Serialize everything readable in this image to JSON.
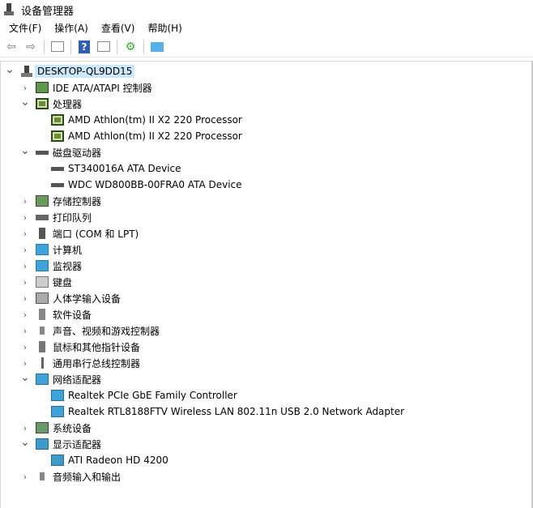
{
  "window": {
    "title": "设备管理器"
  },
  "menu": [
    "文件(F)",
    "操作(A)",
    "查看(V)",
    "帮助(H)"
  ],
  "toolbar": [
    "back-icon",
    "forward-icon",
    "show-hide-console-tree-icon",
    "help-icon",
    "properties-pane-icon",
    "update-driver-icon",
    "scan-hardware-icon"
  ],
  "tree": [
    {
      "label": "DESKTOP-QL9DD15",
      "level": 0,
      "expand": "open",
      "icon": "computer",
      "selected": true
    },
    {
      "label": "IDE ATA/ATAPI 控制器",
      "level": 1,
      "expand": "closed",
      "icon": "controller"
    },
    {
      "label": "处理器",
      "level": 1,
      "expand": "open",
      "icon": "cpu"
    },
    {
      "label": "AMD Athlon(tm) II X2 220 Processor",
      "level": 2,
      "icon": "cpu"
    },
    {
      "label": "AMD Athlon(tm) II X2 220 Processor",
      "level": 2,
      "icon": "cpu"
    },
    {
      "label": "磁盘驱动器",
      "level": 1,
      "expand": "open",
      "icon": "disk"
    },
    {
      "label": "ST340016A ATA Device",
      "level": 2,
      "icon": "disk"
    },
    {
      "label": "WDC WD800BB-00FRA0 ATA Device",
      "level": 2,
      "icon": "disk"
    },
    {
      "label": "存储控制器",
      "level": 1,
      "expand": "closed",
      "icon": "storage"
    },
    {
      "label": "打印队列",
      "level": 1,
      "expand": "closed",
      "icon": "printer"
    },
    {
      "label": "端口 (COM 和 LPT)",
      "level": 1,
      "expand": "closed",
      "icon": "port"
    },
    {
      "label": "计算机",
      "level": 1,
      "expand": "closed",
      "icon": "monitor"
    },
    {
      "label": "监视器",
      "level": 1,
      "expand": "closed",
      "icon": "monitor"
    },
    {
      "label": "键盘",
      "level": 1,
      "expand": "closed",
      "icon": "keyboard"
    },
    {
      "label": "人体学输入设备",
      "level": 1,
      "expand": "closed",
      "icon": "hid"
    },
    {
      "label": "软件设备",
      "level": 1,
      "expand": "closed",
      "icon": "software"
    },
    {
      "label": "声音、视频和游戏控制器",
      "level": 1,
      "expand": "closed",
      "icon": "speaker"
    },
    {
      "label": "鼠标和其他指针设备",
      "level": 1,
      "expand": "closed",
      "icon": "mouse"
    },
    {
      "label": "通用串行总线控制器",
      "level": 1,
      "expand": "closed",
      "icon": "usb"
    },
    {
      "label": "网络适配器",
      "level": 1,
      "expand": "open",
      "icon": "network"
    },
    {
      "label": "Realtek PCIe GbE Family Controller",
      "level": 2,
      "icon": "network"
    },
    {
      "label": "Realtek RTL8188FTV Wireless LAN 802.11n USB 2.0 Network Adapter",
      "level": 2,
      "icon": "network"
    },
    {
      "label": "系统设备",
      "level": 1,
      "expand": "closed",
      "icon": "system"
    },
    {
      "label": "显示适配器",
      "level": 1,
      "expand": "open",
      "icon": "display"
    },
    {
      "label": "ATI Radeon HD 4200",
      "level": 2,
      "icon": "display"
    },
    {
      "label": "音频输入和输出",
      "level": 1,
      "expand": "closed",
      "icon": "speaker"
    }
  ]
}
